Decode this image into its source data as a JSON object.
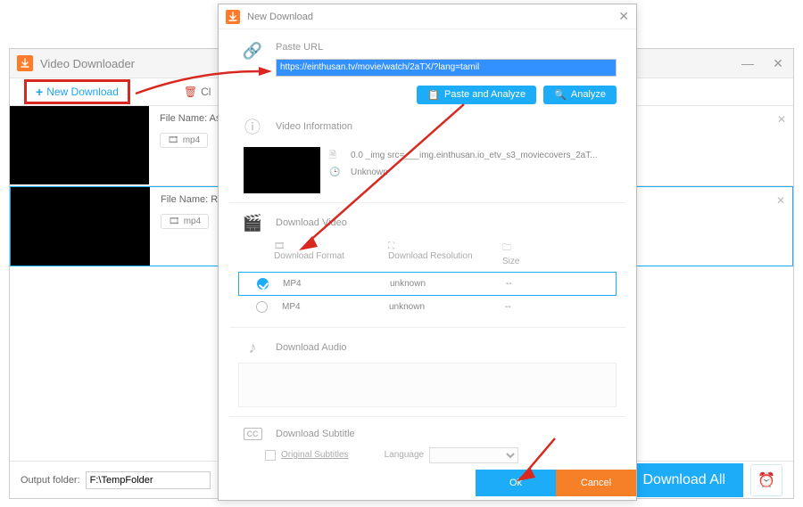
{
  "main": {
    "title": "Video Downloader",
    "newDownload": "New Download",
    "otherToolbar": "Cl",
    "rows": [
      {
        "fileNameLabel": "File Name: Asura",
        "format": "mp4"
      },
      {
        "fileNameLabel": "File Name: Ratsa",
        "format": "mp4"
      }
    ],
    "footer": {
      "outputLabel": "Output folder:",
      "outputValue": "F:\\TempFolder",
      "downloadAll": "Download All"
    }
  },
  "dialog": {
    "title": "New Download",
    "pasteUrlLabel": "Paste URL",
    "urlValue": "https://einthusan.tv/movie/watch/2aTX/?lang=tamil",
    "pasteAnalyze": "Paste and Analyze",
    "analyze": "Analyze",
    "videoInfoLabel": "Video Information",
    "videoTitle": "0.0  _img src=___img.einthusan.io_etv_s3_moviecovers_2aT...",
    "videoAuthor": "Unknown",
    "downloadVideoLabel": "Download Video",
    "headers": {
      "format": "Download Format",
      "resolution": "Download Resolution",
      "size": "Size"
    },
    "formats": [
      {
        "name": "MP4",
        "res": "unknown",
        "size": "--",
        "selected": true
      },
      {
        "name": "MP4",
        "res": "unknown",
        "size": "--",
        "selected": false
      }
    ],
    "downloadAudioLabel": "Download Audio",
    "downloadSubtitleLabel": "Download Subtitle",
    "originalSubs": "Original Subtitles",
    "languageLabel": "Language",
    "ok": "Ok",
    "cancel": "Cancel"
  }
}
